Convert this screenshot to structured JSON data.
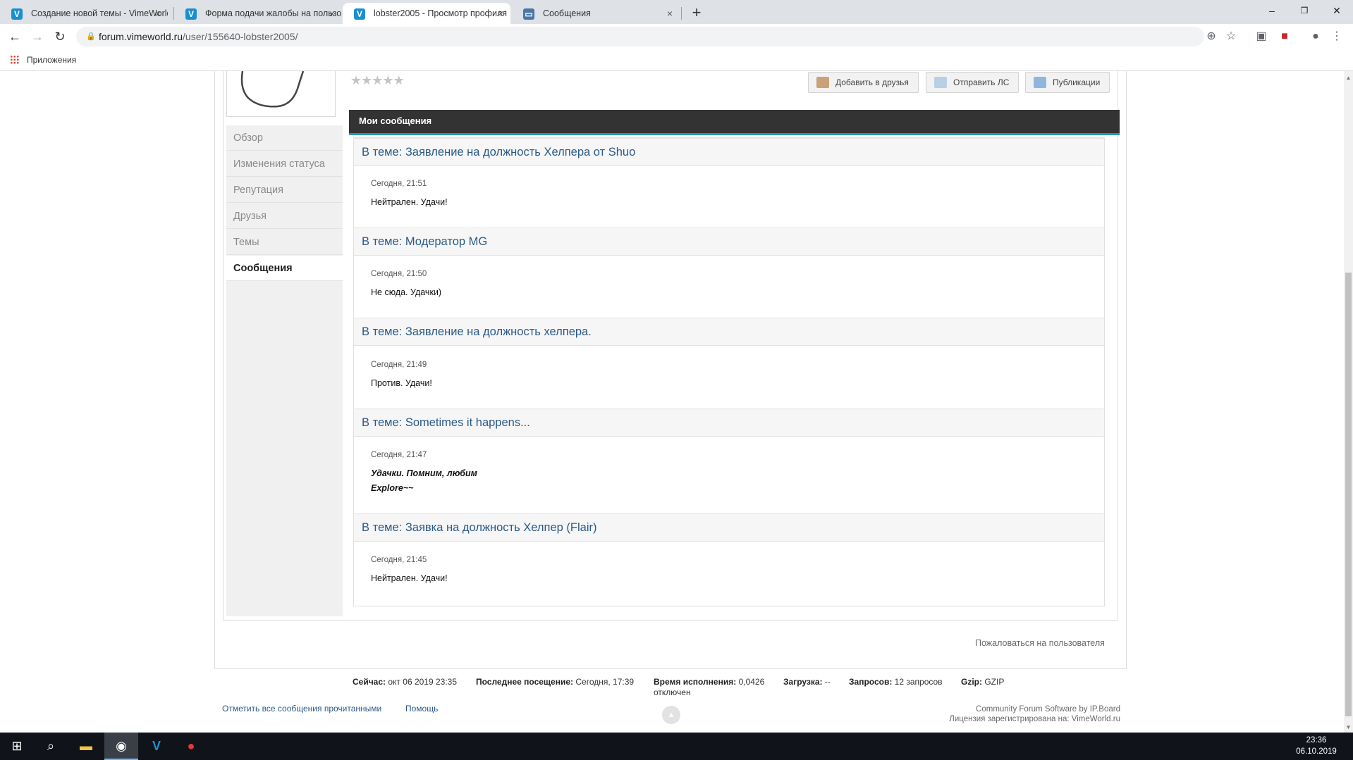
{
  "browser": {
    "tabs": [
      {
        "title": "Создание новой темы - VimeWorld",
        "favicon": "V"
      },
      {
        "title": "Форма подачи жалобы на пользователя",
        "favicon": "V"
      },
      {
        "title": "lobster2005 - Просмотр профиля",
        "favicon": "V"
      },
      {
        "title": "Сообщения",
        "favicon": "chat"
      }
    ],
    "close_glyph": "×",
    "new_tab_glyph": "+",
    "url_host": "forum.vimeworld.ru",
    "url_path": "/user/155640-lobster2005/",
    "bookmarks_label": "Приложения",
    "window_controls": [
      "–",
      "❐",
      "✕"
    ]
  },
  "profile": {
    "rating_stars": 5,
    "actions": {
      "add_friend": "Добавить в друзья",
      "send_pm": "Отправить ЛС",
      "publications": "Публикации"
    },
    "sidebar": [
      "Обзор",
      "Изменения статуса",
      "Репутация",
      "Друзья",
      "Темы",
      "Сообщения"
    ],
    "active_sidebar_index": 5
  },
  "section_title": "Мои сообщения",
  "posts": [
    {
      "title": "В теме: Заявление на должность Хелпера от Shuo",
      "date": "Сегодня, 21:51",
      "body": [
        "Нейтрален. Удачи!"
      ],
      "style": "normal"
    },
    {
      "title": "В теме: Модератор MG",
      "date": "Сегодня, 21:50",
      "body": [
        "Не сюда. Удачки)"
      ],
      "style": "normal"
    },
    {
      "title": "В теме: Заявление на должность хелпера.",
      "date": "Сегодня, 21:49",
      "body": [
        "Против. Удачи!"
      ],
      "style": "normal"
    },
    {
      "title": "В теме: Sometimes it happens...",
      "date": "Сегодня, 21:47",
      "body": [
        "Удачки. Помним, любим",
        "Explore~~"
      ],
      "style": "bold-italic"
    },
    {
      "title": "В теме: Заявка на должность Хелпер (Flair)",
      "date": "Сегодня, 21:45",
      "body": [
        "Нейтрален. Удачи!"
      ],
      "style": "normal"
    }
  ],
  "report_link": "Пожаловаться на пользователя",
  "stats": {
    "now_label": "Сейчас:",
    "now_value": "окт 06 2019 23:35",
    "last_visit_label": "Последнее посещение:",
    "last_visit_value": "Сегодня, 17:39",
    "exec_label": "Время исполнения:",
    "exec_value": "0,0426",
    "load_label": "Загрузка:",
    "load_value": "--",
    "queries_label": "Запросов:",
    "queries_value": "12 запросов",
    "gzip_label": "Gzip:",
    "gzip_value": "GZIP",
    "gzip_state": "отключен"
  },
  "footer": {
    "mark_read": "Отметить все сообщения прочитанными",
    "help": "Помощь",
    "credit_line1": "Community Forum Software by IP.Board",
    "credit_line2": "Лицензия зарегистрирована на: VimeWorld.ru"
  },
  "taskbar": {
    "time": "23:36",
    "date": "06.10.2019"
  },
  "colors": {
    "link": "#2a5a88",
    "header_bg": "#333333",
    "header_accent": "#2a96b5"
  }
}
